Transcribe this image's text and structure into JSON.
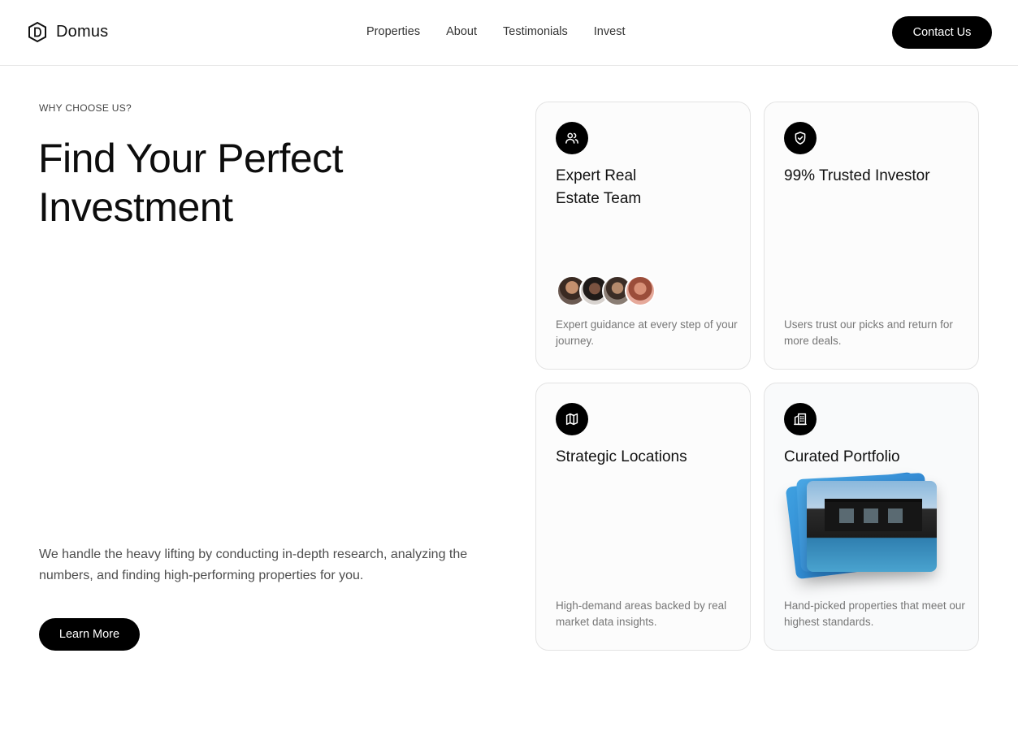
{
  "header": {
    "brand": "Domus",
    "nav": [
      "Properties",
      "About",
      "Testimonials",
      "Invest"
    ],
    "contact_label": "Contact Us"
  },
  "hero": {
    "eyebrow": "WHY CHOOSE US?",
    "title_line1": "Find Your Perfect",
    "title_line2": "Investment",
    "description": "We handle the heavy lifting by conducting in-depth research, analyzing the numbers, and finding high-performing properties for you.",
    "cta_label": "Learn More"
  },
  "cards": [
    {
      "icon": "users-icon",
      "title_line1": "Expert Real",
      "title_line2": "Estate Team",
      "text": "Expert guidance at every step of your journey."
    },
    {
      "icon": "shield-check-icon",
      "title": "99% Trusted Investor",
      "text": "Users trust our picks and return for more deals."
    },
    {
      "icon": "map-icon",
      "title": "Strategic Locations",
      "text": "High-demand areas backed by real market data insights."
    },
    {
      "icon": "building-icon",
      "title": "Curated Portfolio",
      "text": "Hand-picked properties that meet our highest standards."
    }
  ],
  "colors": {
    "primary": "#000000",
    "text": "#111111",
    "muted": "#777777",
    "border": "#e3e3e3"
  }
}
